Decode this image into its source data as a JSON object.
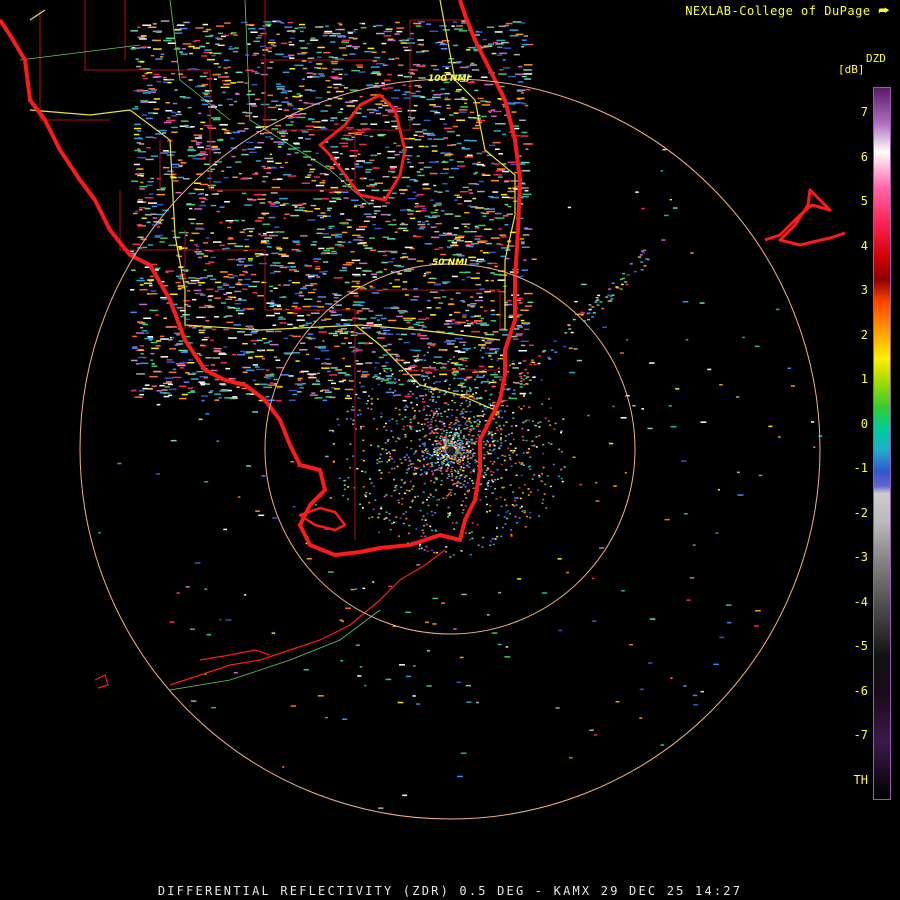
{
  "credit": "NEXLAB-College of DuPage",
  "logo_icon": "cod-logo-icon",
  "footer": "DIFFERENTIAL REFLECTIVITY (ZDR) 0.5 DEG - KAMX 29 DEC 25 14:27",
  "legend": {
    "product": "DZD",
    "unit": "[dB]",
    "ticks": [
      "7",
      "6",
      "5",
      "4",
      "3",
      "2",
      "1",
      "0",
      "-1",
      "-2",
      "-3",
      "-4",
      "-5",
      "-6",
      "-7",
      "TH"
    ]
  },
  "range_rings": [
    "50 NMI",
    "100 NMI"
  ],
  "colors": {
    "coastline": "#ff1a1a",
    "county_lines": "#b01010",
    "range_rings": "#f4b08a",
    "state_roads": "#ffff33",
    "text": "#ffff33",
    "footer_text": "#e8e8e8"
  }
}
